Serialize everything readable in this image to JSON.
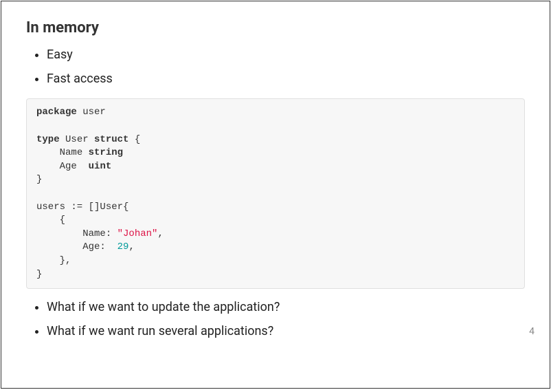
{
  "title": "In memory",
  "bullets_top": [
    "Easy",
    "Fast access"
  ],
  "code": {
    "kw_package": "package",
    "pkg_name": "user",
    "kw_type": "type",
    "type_name": "User",
    "kw_struct": "struct",
    "open_brace": " {",
    "field_name": "Name",
    "field_name_type": "string",
    "field_age": "Age",
    "field_age_type": "uint",
    "close_brace": "}",
    "assign_line": "users := []User{",
    "inner_open": "    {",
    "name_key": "        Name: ",
    "name_val": "\"Johan\"",
    "comma1": ",",
    "age_key": "        Age:  ",
    "age_val": "29",
    "comma2": ",",
    "inner_close": "    },",
    "outer_close": "}"
  },
  "bullets_bottom": [
    "What if we want to update the application?",
    "What if we want run several applications?"
  ],
  "page_number": "4"
}
